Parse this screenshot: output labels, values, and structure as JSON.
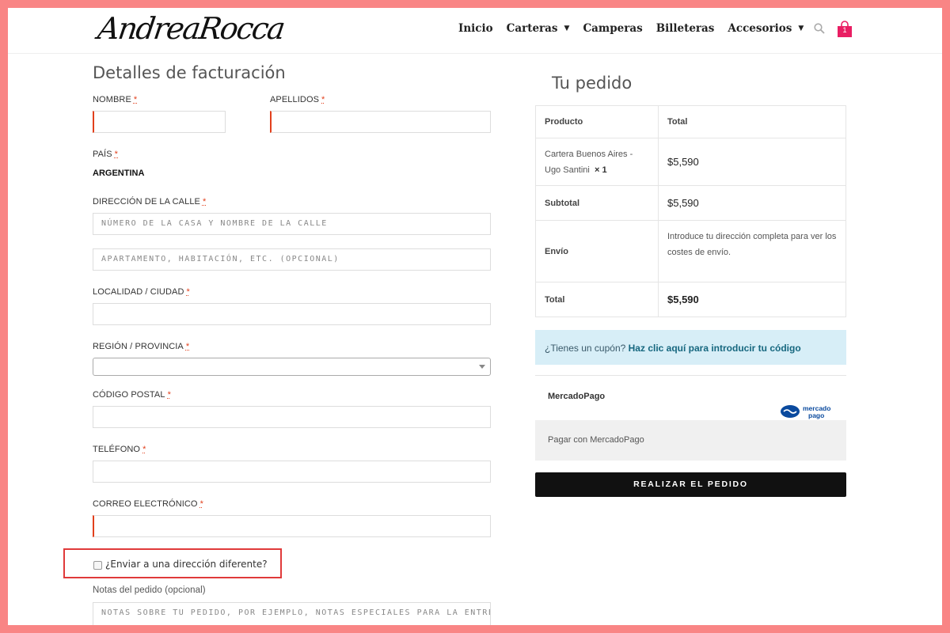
{
  "header": {
    "logo": "AndreaRocca",
    "nav": [
      {
        "label": "Inicio",
        "dropdown": false
      },
      {
        "label": "Carteras",
        "dropdown": true
      },
      {
        "label": "Camperas",
        "dropdown": false
      },
      {
        "label": "Billeteras",
        "dropdown": false
      },
      {
        "label": "Accesorios",
        "dropdown": true
      }
    ],
    "cart_count": "1"
  },
  "billing": {
    "title": "Detalles de facturación",
    "required_mark": "*",
    "nombre_label": "NOMBRE",
    "apellidos_label": "APELLIDOS",
    "pais_label": "PAÍS",
    "pais_value": "ARGENTINA",
    "direccion_label": "DIRECCIÓN DE LA CALLE",
    "direccion_placeholder": "NÚMERO DE LA CASA Y NOMBRE DE LA CALLE",
    "direccion2_placeholder": "APARTAMENTO, HABITACIÓN, ETC. (OPCIONAL)",
    "localidad_label": "LOCALIDAD / CIUDAD",
    "region_label": "REGIÓN / PROVINCIA",
    "codigo_label": "CÓDIGO POSTAL",
    "telefono_label": "TELÉFONO",
    "correo_label": "CORREO ELECTRÓNICO",
    "ship_different_label": "¿Enviar a una dirección diferente?",
    "notas_label": "Notas del pedido (opcional)",
    "notas_placeholder": "NOTAS SOBRE TU PEDIDO, POR EJEMPLO, NOTAS ESPECIALES PARA LA ENTREGA."
  },
  "order": {
    "title": "Tu pedido",
    "col_product": "Producto",
    "col_total": "Total",
    "item_name": "Cartera Buenos Aires - Ugo Santini",
    "item_qty": "× 1",
    "item_price": "$5,590",
    "subtotal_label": "Subtotal",
    "subtotal_value": "$5,590",
    "envio_label": "Envío",
    "envio_text": "Introduce tu dirección completa para ver los costes de envío.",
    "total_label": "Total",
    "total_value": "$5,590"
  },
  "coupon": {
    "question": "¿Tienes un cupón?",
    "link": "Haz clic aquí para introducir tu código"
  },
  "payment": {
    "method": "MercadoPago",
    "logo_line1": "mercado",
    "logo_line2": "pago",
    "description": "Pagar con MercadoPago",
    "place_order": "REALIZAR EL PEDIDO"
  },
  "colors": {
    "accent": "#e2401c",
    "cart": "#e91e63",
    "frame": "#f98585",
    "highlight": "#e03a3a"
  }
}
